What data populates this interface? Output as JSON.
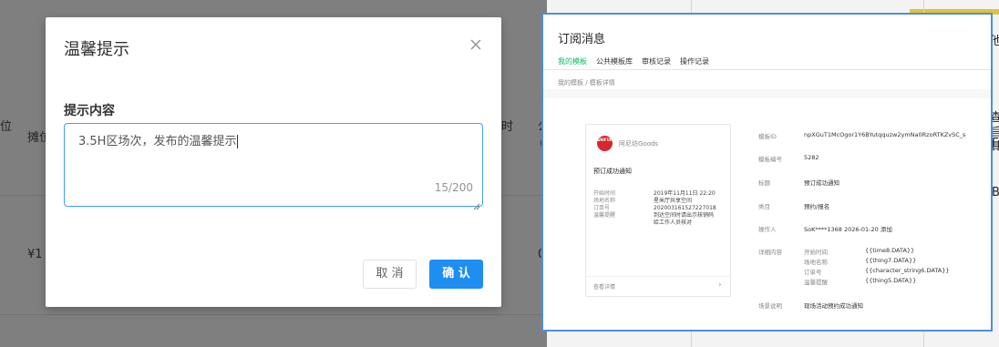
{
  "background_table": {
    "header_left": "位",
    "header_stall": "摊位",
    "header_right": "时",
    "header_partial": "公",
    "header_paren": "(",
    "row_price": "¥1",
    "row_zero": "0"
  },
  "right_edge": {
    "chars": [
      "他",
      "查",
      "旨",
      "E",
      "其",
      "B"
    ]
  },
  "modal": {
    "title": "温馨提示",
    "label": "提示内容",
    "textarea_value": "3.5H区场次，发布的温馨提示",
    "char_count": "15/200",
    "cancel_label": "取 消",
    "confirm_label": "确 认"
  },
  "wechat": {
    "title": "订阅消息",
    "tabs": [
      "我的模板",
      "公共模板库",
      "审核记录",
      "操作记录"
    ],
    "breadcrumb": "我的模板 / 模板详情",
    "card": {
      "logo_text": "ANIFUN",
      "brand": "阿尼坊Goods",
      "title": "预订成功通知",
      "rows": [
        {
          "k": "开始时间",
          "v": "2019年11月11日 22:20"
        },
        {
          "k": "场地名称",
          "v": "星米厅共享空间"
        },
        {
          "k": "订单号",
          "v": "202003161527227018"
        },
        {
          "k": "温馨提醒",
          "v": "到达空间时请出示核销码"
        },
        {
          "k": "",
          "v": "给工作人员核对"
        }
      ],
      "footer": "查看详情",
      "arrow": "›"
    },
    "detail": {
      "template_id_label": "模板ID",
      "template_id": "npXGuT1McOgor1Y6BYutqquzw2ymNa0RzoRTKZvSC_s",
      "template_no_label": "模板编号",
      "template_no": "5282",
      "title_label": "标题",
      "title": "预订成功通知",
      "category_label": "类目",
      "category": "预约/报名",
      "operator_label": "操作人",
      "operator": "SoK****1368 2026-01-20 添加",
      "content_label": "详细内容",
      "fields": [
        {
          "k": "开始时间",
          "v": "{{time8.DATA}}"
        },
        {
          "k": "场地名称",
          "v": "{{thing7.DATA}}"
        },
        {
          "k": "订单号",
          "v": "{{character_string6.DATA}}"
        },
        {
          "k": "温馨提醒",
          "v": "{{thing5.DATA}}"
        }
      ],
      "scene_label": "场景说明",
      "scene": "现场活动预约成功通知"
    }
  },
  "colors": {
    "primary": "#1f8ef1",
    "focus_border": "#409eff",
    "wechat_green": "#07c160",
    "window_border": "#4a90e2",
    "gold_strip": "#e3c13b"
  }
}
